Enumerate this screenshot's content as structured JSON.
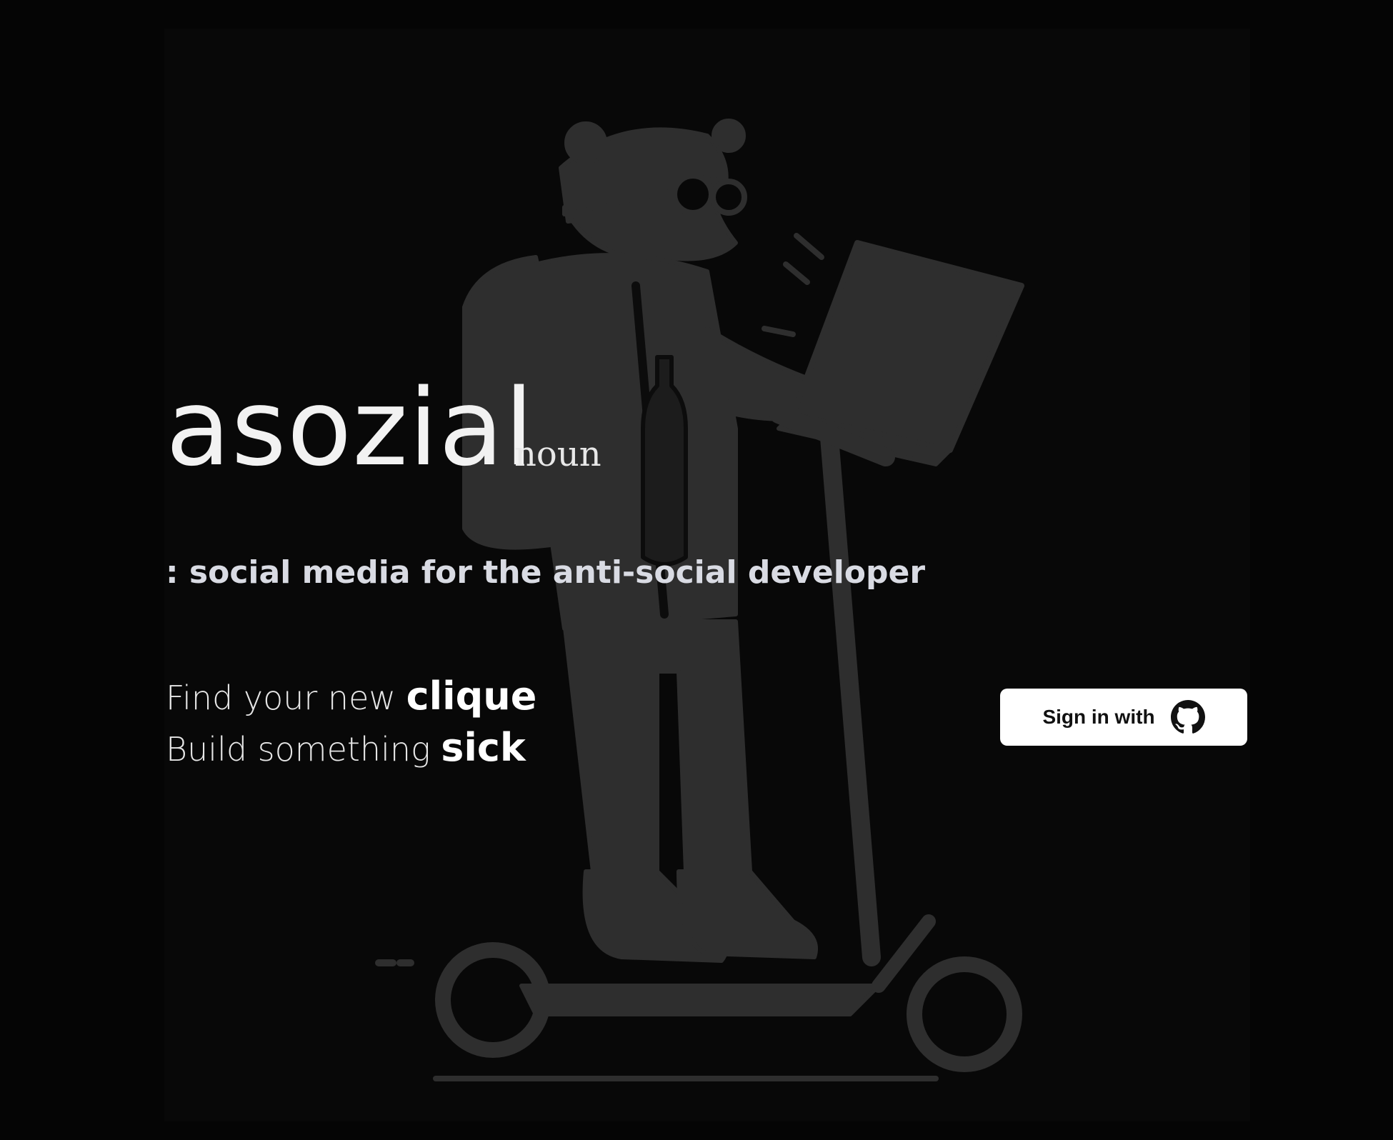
{
  "brand": {
    "title": "asozial",
    "part_of_speech": "noun",
    "definition": ": social media for the anti-social developer"
  },
  "taglines": [
    {
      "prefix": "Find your new ",
      "emphasis": "clique"
    },
    {
      "prefix": "Build something ",
      "emphasis": "sick"
    }
  ],
  "auth": {
    "signin_label": "Sign in with",
    "provider_icon": "github-icon"
  },
  "colors": {
    "background": "#050505",
    "illustration": "#2e2e2e",
    "button_bg": "#ffffff",
    "button_text": "#111111"
  }
}
